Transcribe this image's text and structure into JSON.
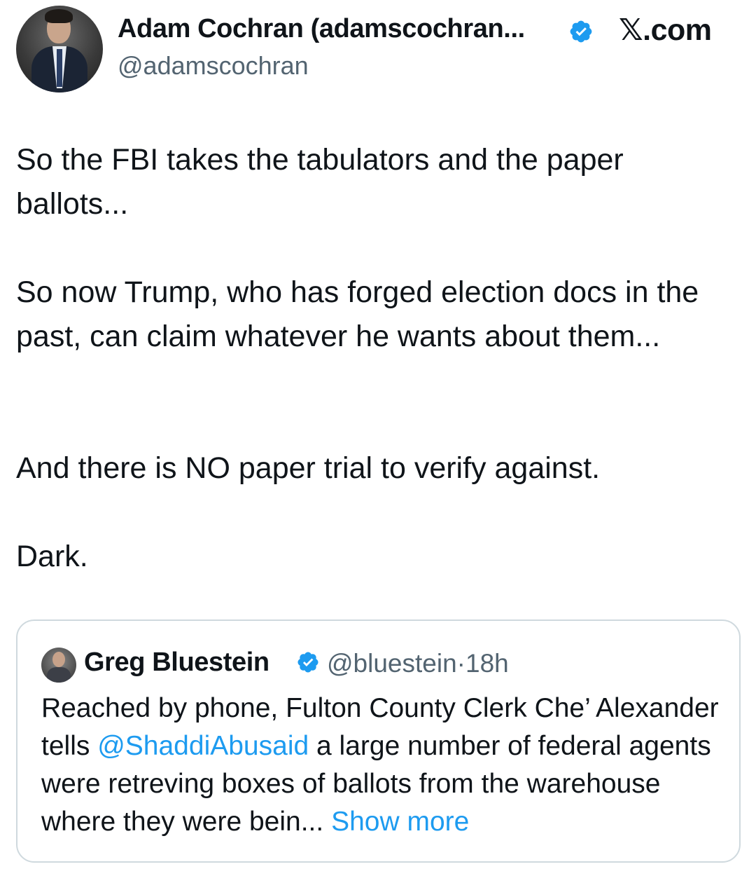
{
  "tweet": {
    "author": {
      "display_name": "Adam Cochran (adamscochran...",
      "handle": "@adamscochran",
      "verified": true
    },
    "source_label": "𝕏.com",
    "paragraphs": [
      "So the FBI takes the tabulators and the paper ballots...",
      "So now Trump, who has forged election docs in the past, can claim whatever he wants about them...",
      "And there is NO paper trial to verify against.",
      "Dark."
    ]
  },
  "quoted_tweet": {
    "author": {
      "display_name": "Greg Bluestein",
      "handle": "@bluestein",
      "verified": true
    },
    "separator": "·",
    "time_ago": "18h",
    "text_before_mention": "Reached by phone, Fulton County Clerk Che’ Alexander tells ",
    "mention": "@ShaddiAbusaid",
    "text_after_mention": " a large number of federal agents were retreving boxes of ballots from the warehouse where they were bein...",
    "show_more_label": "Show more"
  },
  "colors": {
    "text": "#0f1419",
    "secondary_text": "#536471",
    "link": "#1d9bf0",
    "verified_badge": "#1d9bf0",
    "card_border": "#cfd9de"
  }
}
